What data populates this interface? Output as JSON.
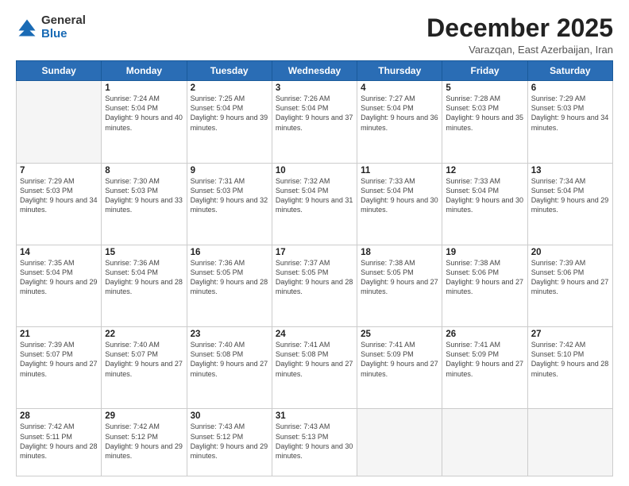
{
  "logo": {
    "general": "General",
    "blue": "Blue"
  },
  "title": "December 2025",
  "location": "Varazqan, East Azerbaijan, Iran",
  "days_header": [
    "Sunday",
    "Monday",
    "Tuesday",
    "Wednesday",
    "Thursday",
    "Friday",
    "Saturday"
  ],
  "weeks": [
    [
      {
        "day": "",
        "sunrise": "",
        "sunset": "",
        "daylight": "",
        "empty": true
      },
      {
        "day": "1",
        "sunrise": "Sunrise: 7:24 AM",
        "sunset": "Sunset: 5:04 PM",
        "daylight": "Daylight: 9 hours and 40 minutes."
      },
      {
        "day": "2",
        "sunrise": "Sunrise: 7:25 AM",
        "sunset": "Sunset: 5:04 PM",
        "daylight": "Daylight: 9 hours and 39 minutes."
      },
      {
        "day": "3",
        "sunrise": "Sunrise: 7:26 AM",
        "sunset": "Sunset: 5:04 PM",
        "daylight": "Daylight: 9 hours and 37 minutes."
      },
      {
        "day": "4",
        "sunrise": "Sunrise: 7:27 AM",
        "sunset": "Sunset: 5:04 PM",
        "daylight": "Daylight: 9 hours and 36 minutes."
      },
      {
        "day": "5",
        "sunrise": "Sunrise: 7:28 AM",
        "sunset": "Sunset: 5:03 PM",
        "daylight": "Daylight: 9 hours and 35 minutes."
      },
      {
        "day": "6",
        "sunrise": "Sunrise: 7:29 AM",
        "sunset": "Sunset: 5:03 PM",
        "daylight": "Daylight: 9 hours and 34 minutes."
      }
    ],
    [
      {
        "day": "7",
        "sunrise": "Sunrise: 7:29 AM",
        "sunset": "Sunset: 5:03 PM",
        "daylight": "Daylight: 9 hours and 34 minutes."
      },
      {
        "day": "8",
        "sunrise": "Sunrise: 7:30 AM",
        "sunset": "Sunset: 5:03 PM",
        "daylight": "Daylight: 9 hours and 33 minutes."
      },
      {
        "day": "9",
        "sunrise": "Sunrise: 7:31 AM",
        "sunset": "Sunset: 5:03 PM",
        "daylight": "Daylight: 9 hours and 32 minutes."
      },
      {
        "day": "10",
        "sunrise": "Sunrise: 7:32 AM",
        "sunset": "Sunset: 5:04 PM",
        "daylight": "Daylight: 9 hours and 31 minutes."
      },
      {
        "day": "11",
        "sunrise": "Sunrise: 7:33 AM",
        "sunset": "Sunset: 5:04 PM",
        "daylight": "Daylight: 9 hours and 30 minutes."
      },
      {
        "day": "12",
        "sunrise": "Sunrise: 7:33 AM",
        "sunset": "Sunset: 5:04 PM",
        "daylight": "Daylight: 9 hours and 30 minutes."
      },
      {
        "day": "13",
        "sunrise": "Sunrise: 7:34 AM",
        "sunset": "Sunset: 5:04 PM",
        "daylight": "Daylight: 9 hours and 29 minutes."
      }
    ],
    [
      {
        "day": "14",
        "sunrise": "Sunrise: 7:35 AM",
        "sunset": "Sunset: 5:04 PM",
        "daylight": "Daylight: 9 hours and 29 minutes."
      },
      {
        "day": "15",
        "sunrise": "Sunrise: 7:36 AM",
        "sunset": "Sunset: 5:04 PM",
        "daylight": "Daylight: 9 hours and 28 minutes."
      },
      {
        "day": "16",
        "sunrise": "Sunrise: 7:36 AM",
        "sunset": "Sunset: 5:05 PM",
        "daylight": "Daylight: 9 hours and 28 minutes."
      },
      {
        "day": "17",
        "sunrise": "Sunrise: 7:37 AM",
        "sunset": "Sunset: 5:05 PM",
        "daylight": "Daylight: 9 hours and 28 minutes."
      },
      {
        "day": "18",
        "sunrise": "Sunrise: 7:38 AM",
        "sunset": "Sunset: 5:05 PM",
        "daylight": "Daylight: 9 hours and 27 minutes."
      },
      {
        "day": "19",
        "sunrise": "Sunrise: 7:38 AM",
        "sunset": "Sunset: 5:06 PM",
        "daylight": "Daylight: 9 hours and 27 minutes."
      },
      {
        "day": "20",
        "sunrise": "Sunrise: 7:39 AM",
        "sunset": "Sunset: 5:06 PM",
        "daylight": "Daylight: 9 hours and 27 minutes."
      }
    ],
    [
      {
        "day": "21",
        "sunrise": "Sunrise: 7:39 AM",
        "sunset": "Sunset: 5:07 PM",
        "daylight": "Daylight: 9 hours and 27 minutes."
      },
      {
        "day": "22",
        "sunrise": "Sunrise: 7:40 AM",
        "sunset": "Sunset: 5:07 PM",
        "daylight": "Daylight: 9 hours and 27 minutes."
      },
      {
        "day": "23",
        "sunrise": "Sunrise: 7:40 AM",
        "sunset": "Sunset: 5:08 PM",
        "daylight": "Daylight: 9 hours and 27 minutes."
      },
      {
        "day": "24",
        "sunrise": "Sunrise: 7:41 AM",
        "sunset": "Sunset: 5:08 PM",
        "daylight": "Daylight: 9 hours and 27 minutes."
      },
      {
        "day": "25",
        "sunrise": "Sunrise: 7:41 AM",
        "sunset": "Sunset: 5:09 PM",
        "daylight": "Daylight: 9 hours and 27 minutes."
      },
      {
        "day": "26",
        "sunrise": "Sunrise: 7:41 AM",
        "sunset": "Sunset: 5:09 PM",
        "daylight": "Daylight: 9 hours and 27 minutes."
      },
      {
        "day": "27",
        "sunrise": "Sunrise: 7:42 AM",
        "sunset": "Sunset: 5:10 PM",
        "daylight": "Daylight: 9 hours and 28 minutes."
      }
    ],
    [
      {
        "day": "28",
        "sunrise": "Sunrise: 7:42 AM",
        "sunset": "Sunset: 5:11 PM",
        "daylight": "Daylight: 9 hours and 28 minutes."
      },
      {
        "day": "29",
        "sunrise": "Sunrise: 7:42 AM",
        "sunset": "Sunset: 5:12 PM",
        "daylight": "Daylight: 9 hours and 29 minutes."
      },
      {
        "day": "30",
        "sunrise": "Sunrise: 7:43 AM",
        "sunset": "Sunset: 5:12 PM",
        "daylight": "Daylight: 9 hours and 29 minutes."
      },
      {
        "day": "31",
        "sunrise": "Sunrise: 7:43 AM",
        "sunset": "Sunset: 5:13 PM",
        "daylight": "Daylight: 9 hours and 30 minutes."
      },
      {
        "day": "",
        "sunrise": "",
        "sunset": "",
        "daylight": "",
        "empty": true
      },
      {
        "day": "",
        "sunrise": "",
        "sunset": "",
        "daylight": "",
        "empty": true
      },
      {
        "day": "",
        "sunrise": "",
        "sunset": "",
        "daylight": "",
        "empty": true
      }
    ]
  ]
}
